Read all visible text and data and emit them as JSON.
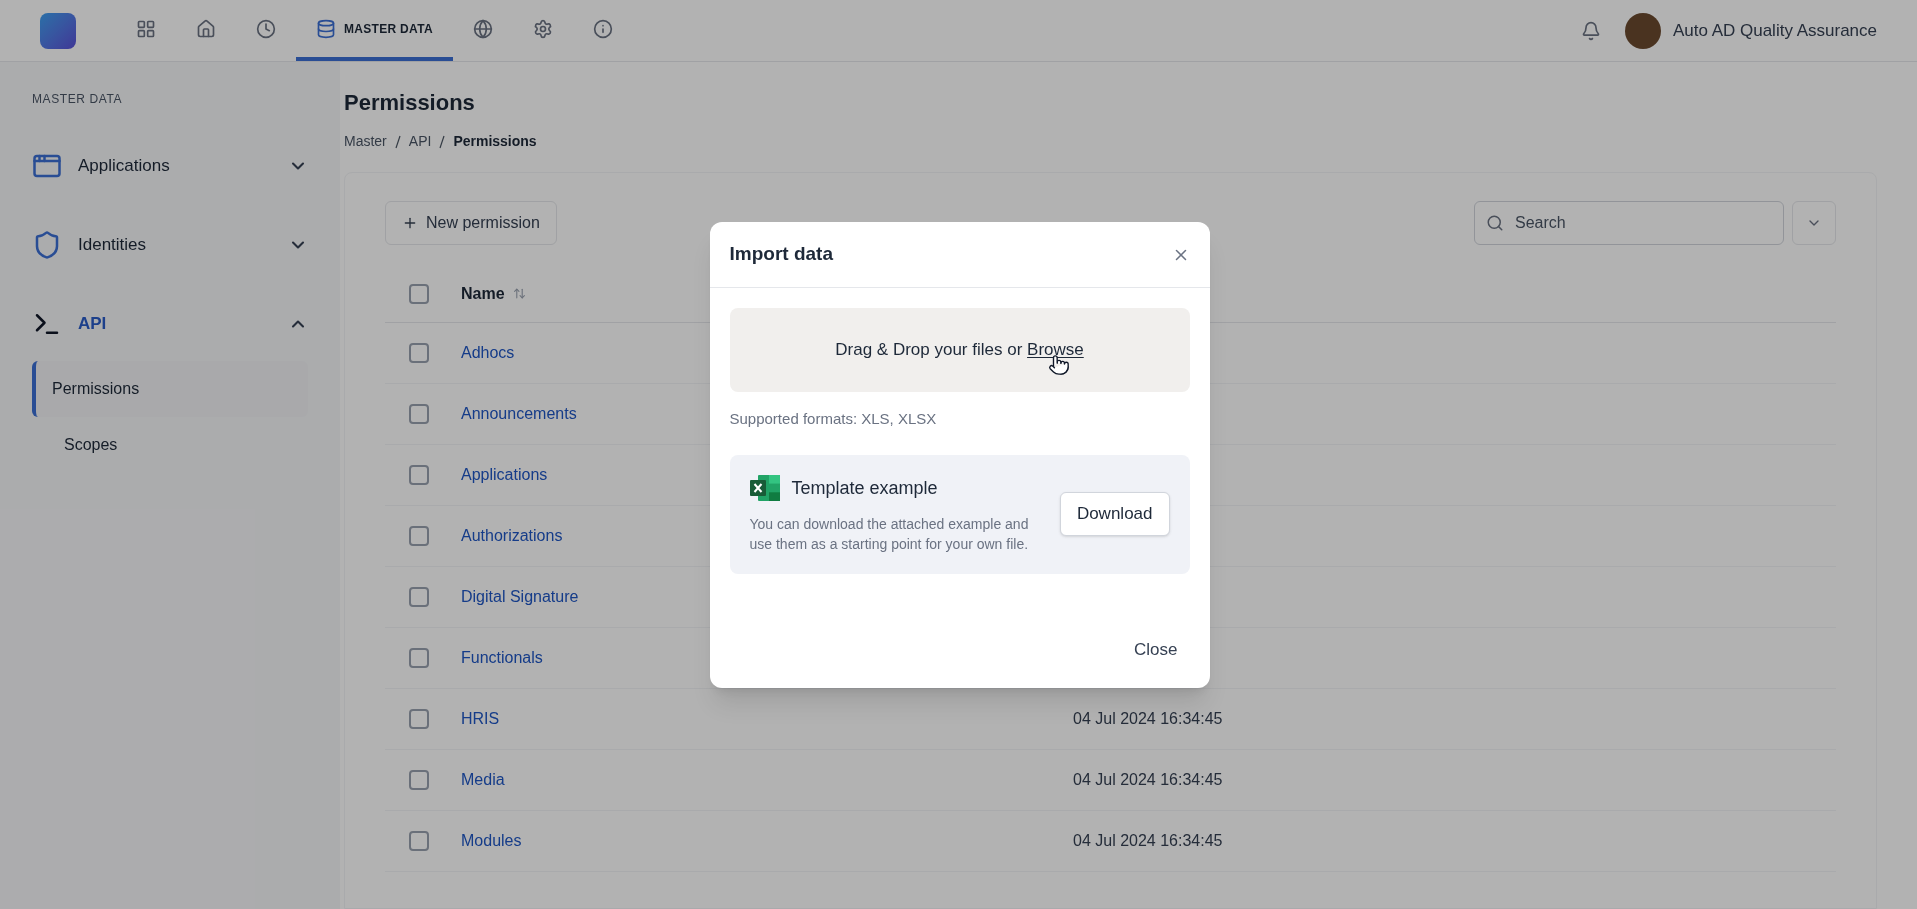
{
  "top_nav": {
    "items": [
      {
        "kind": "grid",
        "selected": false
      },
      {
        "kind": "home",
        "selected": false
      },
      {
        "kind": "clock",
        "selected": false
      },
      {
        "kind": "database",
        "label": "MASTER DATA",
        "selected": true
      },
      {
        "kind": "globe",
        "selected": false
      },
      {
        "kind": "settings",
        "selected": false
      },
      {
        "kind": "info",
        "selected": false
      }
    ],
    "user": {
      "name": "Auto AD Quality Assurance"
    }
  },
  "sidebar": {
    "heading": "MASTER DATA",
    "groups": [
      {
        "kind": "apps",
        "label": "Applications",
        "selected": false,
        "expanded": false
      },
      {
        "kind": "shield",
        "label": "Identities",
        "selected": false,
        "expanded": false
      },
      {
        "kind": "terminal",
        "label": "API",
        "selected": true,
        "expanded": true,
        "children": [
          {
            "label": "Permissions",
            "selected": true
          },
          {
            "label": "Scopes",
            "selected": false
          }
        ]
      }
    ]
  },
  "page": {
    "title": "Permissions",
    "breadcrumb": [
      "Master",
      "API",
      "Permissions"
    ],
    "new_button": "New permission",
    "search": {
      "placeholder": "Search"
    }
  },
  "table": {
    "columns": [
      "Name"
    ],
    "header_checked": false,
    "rows": [
      {
        "name": "Adhocs",
        "checked": false
      },
      {
        "name": "Announcements",
        "checked": false
      },
      {
        "name": "Applications",
        "checked": false
      },
      {
        "name": "Authorizations",
        "checked": false
      },
      {
        "name": "Digital Signature",
        "checked": false
      },
      {
        "name": "Functionals",
        "checked": false
      },
      {
        "name": "HRIS",
        "date": "04 Jul 2024 16:34:45",
        "checked": false
      },
      {
        "name": "Media",
        "date": "04 Jul 2024 16:34:45",
        "checked": false
      },
      {
        "name": "Modules",
        "date": "04 Jul 2024 16:34:45",
        "checked": false
      }
    ]
  },
  "dialog": {
    "title": "Import data",
    "dropzone": {
      "text": "Drag & Drop your files or",
      "link": "Browse"
    },
    "formats": "Supported formats: XLS, XLSX",
    "template": {
      "title": "Template example",
      "description": "You can download the attached example and use them as a starting point for your own file.",
      "button": "Download"
    },
    "close_button": "Close"
  }
}
